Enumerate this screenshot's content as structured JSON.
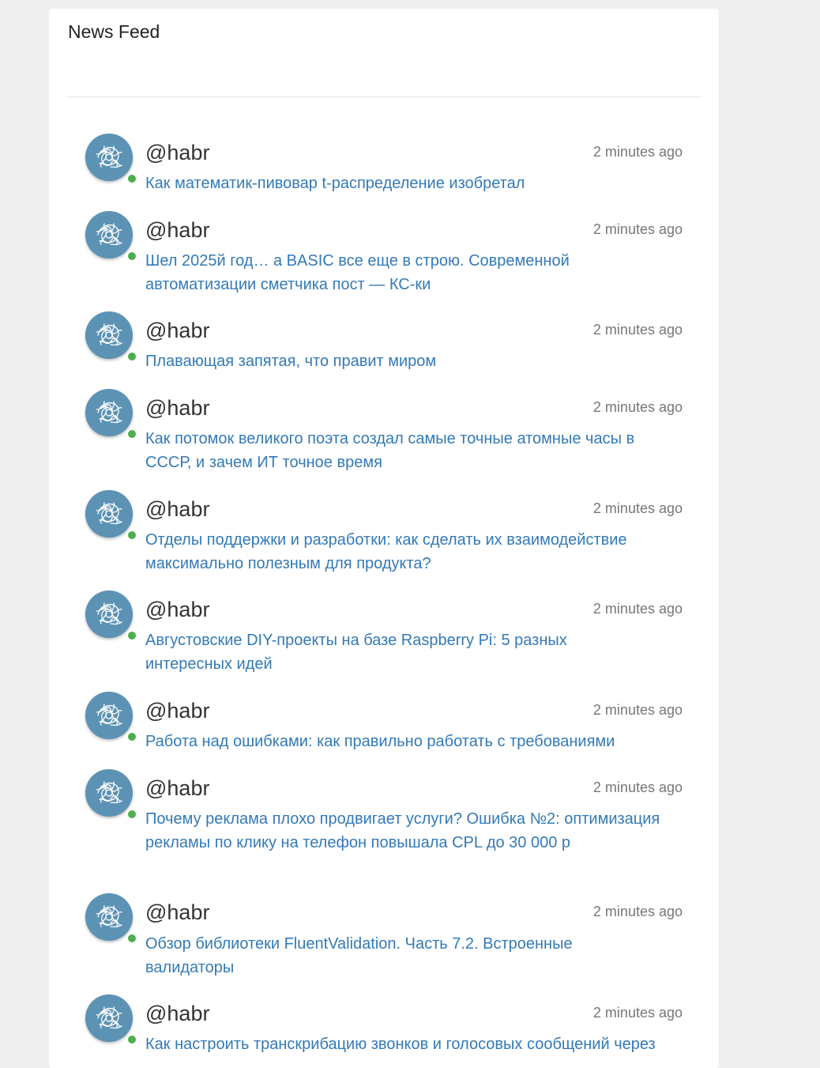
{
  "header": {
    "title": "News Feed"
  },
  "feed": {
    "items": [
      {
        "user": "@habr",
        "time": "2 minutes ago",
        "title": "Как математик-пивовар t-распределение изобретал"
      },
      {
        "user": "@habr",
        "time": "2 minutes ago",
        "title": "Шел 2025й год… а BASIC все еще в строю. Современной автоматизации сметчика пост — КС-ки"
      },
      {
        "user": "@habr",
        "time": "2 minutes ago",
        "title": "Плавающая запятая, что правит миром"
      },
      {
        "user": "@habr",
        "time": "2 minutes ago",
        "title": "Как потомок великого поэта создал самые точные атомные часы в СССР, и зачем ИТ точное время"
      },
      {
        "user": "@habr",
        "time": "2 minutes ago",
        "title": "Отделы поддержки и разработки: как сделать их взаимодействие максимально полезным для продукта?"
      },
      {
        "user": "@habr",
        "time": "2 minutes ago",
        "title": "Августовские DIY-проекты на базе Raspberry Pi: 5 разных интересных идей"
      },
      {
        "user": "@habr",
        "time": "2 minutes ago",
        "title": "Работа над ошибками: как правильно работать с требованиями"
      },
      {
        "user": "@habr",
        "time": "2 minutes ago",
        "title": "Почему реклама плохо продвигает услуги? Ошибка №2: оптимизация рекламы по клику на телефон повышала CPL до 30 000 р"
      },
      {
        "user": "@habr",
        "time": "2 minutes ago",
        "title": "Обзор библиотеки FluentValidation. Часть 7.2. Встроенные валидаторы"
      },
      {
        "user": "@habr",
        "time": "2 minutes ago",
        "title": "Как настроить транскрибацию звонков и голосовых сообщений через"
      }
    ]
  },
  "colors": {
    "link": "#337ab7",
    "avatar": "#5c93b5",
    "online": "#4cae4c",
    "background": "#eeeeee"
  },
  "icons": {
    "avatar": "habr-logo-icon",
    "status": "online-status-icon"
  }
}
